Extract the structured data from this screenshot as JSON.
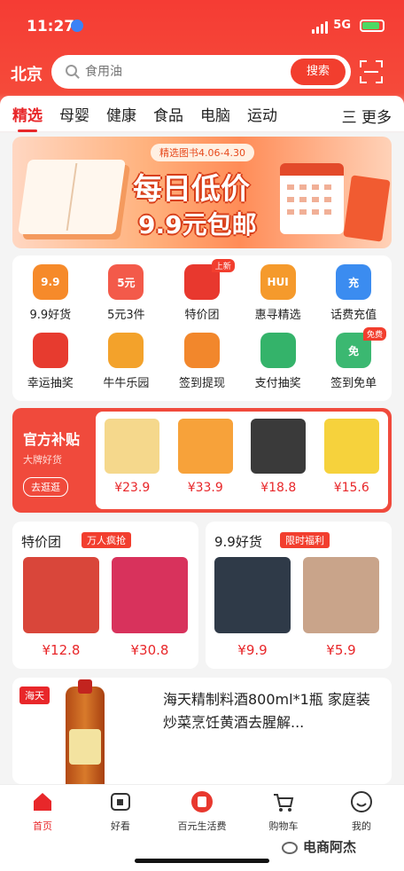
{
  "status": {
    "time": "11:27",
    "network": "5G"
  },
  "header": {
    "city": "北京",
    "search_placeholder": "食用油",
    "search_button": "搜索"
  },
  "tabs": {
    "items": [
      "精选",
      "母婴",
      "健康",
      "食品",
      "电脑",
      "运动"
    ],
    "more": "三 更多"
  },
  "banner": {
    "pill": "精选图书4.06-4.30",
    "title1": "每日低价",
    "title2": "9.9元包邮"
  },
  "quick_icons": [
    {
      "label": "9.9好货",
      "icon": "9.9",
      "color": "#f68a2a"
    },
    {
      "label": "5元3件",
      "icon": "5元",
      "color": "#f35a4a"
    },
    {
      "label": "特价团",
      "icon": "",
      "color": "#e8382e",
      "badge": "上新"
    },
    {
      "label": "惠寻精选",
      "icon": "HUI",
      "color": "#f59a2c"
    },
    {
      "label": "话费充值",
      "icon": "充",
      "color": "#3b8cf0"
    },
    {
      "label": "幸运抽奖",
      "icon": "",
      "color": "#e73b2f"
    },
    {
      "label": "牛牛乐园",
      "icon": "",
      "color": "#f3a22b"
    },
    {
      "label": "签到提现",
      "icon": "",
      "color": "#f2872c"
    },
    {
      "label": "支付抽奖",
      "icon": "",
      "color": "#34b36a"
    },
    {
      "label": "签到免单",
      "icon": "免",
      "color": "#3bb871",
      "badge": "免费"
    }
  ],
  "subsidy": {
    "title": "官方补贴",
    "subtitle": "大牌好货",
    "button": "去逛逛",
    "products": [
      {
        "price": "¥23.9",
        "color": "#f5d88c"
      },
      {
        "price": "¥33.9",
        "color": "#f7a23a"
      },
      {
        "price": "¥18.8",
        "color": "#3a3a3a"
      },
      {
        "price": "¥15.6",
        "color": "#f6d23c"
      }
    ]
  },
  "panel_left": {
    "title": "特价团",
    "tag": "万人疯抢",
    "products": [
      {
        "price": "¥12.8",
        "color": "#d9463a"
      },
      {
        "price": "¥30.8",
        "color": "#d8325c"
      }
    ]
  },
  "panel_right": {
    "title": "9.9好货",
    "tag": "限时福利",
    "products": [
      {
        "price": "¥9.9",
        "color": "#2f3a48"
      },
      {
        "price": "¥5.9",
        "color": "#c9a48a"
      }
    ]
  },
  "product_card": {
    "brand": "海天",
    "title": "海天精制料酒800ml*1瓶 家庭装炒菜烹饪黄酒去腥解..."
  },
  "bottom_nav": [
    {
      "label": "首页",
      "active": true
    },
    {
      "label": "好看",
      "active": false
    },
    {
      "label": "百元生活费",
      "active": false
    },
    {
      "label": "购物车",
      "active": false
    },
    {
      "label": "我的",
      "active": false
    }
  ],
  "watermark": "电商阿杰",
  "colors": {
    "primary": "#f23e2e",
    "price": "#e8272a"
  }
}
